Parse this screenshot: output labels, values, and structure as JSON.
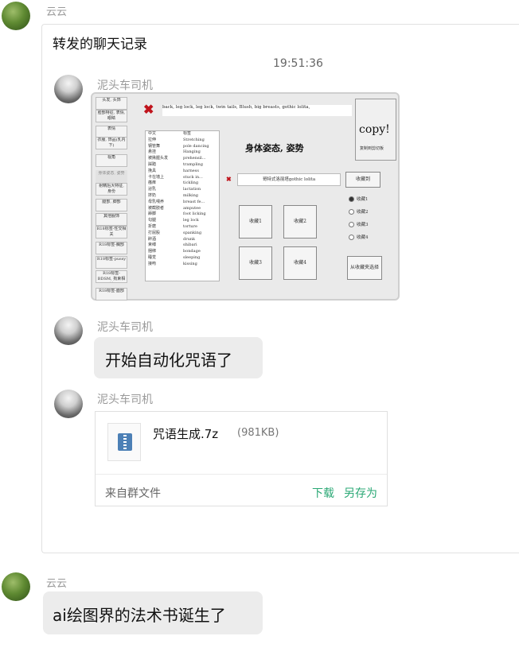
{
  "messages": {
    "m1": {
      "sender": "云云"
    },
    "forward": {
      "title": "转发的聊天记录",
      "time": "19:51:36",
      "sender1": "泥头车司机",
      "sender2": "泥头车司机",
      "sender3": "泥头车司机",
      "text2": "开始自动化咒语了",
      "file": {
        "name": "咒语生成.7z",
        "size": "(981KB)",
        "source": "来自群文件",
        "download": "下载",
        "save_as": "另存为"
      }
    },
    "m2": {
      "sender": "云云",
      "text": "ai绘图界的法术书诞生了"
    }
  },
  "app_shot": {
    "prompt_text": "back, leg lock, leg lock, twin tails, Blush, big breasts, gothic lolita,",
    "copy_label": "copy!",
    "copy_sub": "复制到剪切板",
    "side_buttons": [
      "头发, 头饰",
      "脸部特征, 表情, 眼睛",
      "表情",
      "衣服, 饰品(乳内下)",
      "视角",
      "身体姿态, 姿势",
      "射精后大特征, 身份",
      "腿部, 脚部",
      "其他服饰",
      "R18标签-性交相关",
      "R18标签-胸部",
      "R18标签-pussy",
      "R18标签-BDSM, 拘束相关",
      "R18标签-面部"
    ],
    "table_header": [
      "中文",
      "标签"
    ],
    "table_rows": [
      [
        "拉伸",
        "Stretching"
      ],
      [
        "钢管舞",
        "pole dancing"
      ],
      [
        "悬挂",
        "Hanging"
      ],
      [
        "被揪握头发",
        "prehensil..."
      ],
      [
        "踩踏",
        "trampling"
      ],
      [
        "挽具",
        "harness"
      ],
      [
        "卡在墙上",
        "stuck in..."
      ],
      [
        "瘙痒",
        "tickling"
      ],
      [
        "泌乳",
        "lactation"
      ],
      [
        "挤奶",
        "milking"
      ],
      [
        "母乳喂养",
        "breast fe..."
      ],
      [
        "被截肢者",
        "amputee"
      ],
      [
        "舔脚",
        "foot licking"
      ],
      [
        "勾腿",
        "leg lock"
      ],
      [
        "折磨",
        "torture"
      ],
      [
        "打屁股",
        "spanking"
      ],
      [
        "醉酒",
        "drunk"
      ],
      [
        "束缚",
        "shibari"
      ],
      [
        "捆绑",
        "bondage"
      ],
      [
        "睡觉",
        "sleeping"
      ],
      [
        "接吻",
        "kissing"
      ]
    ],
    "category_title": "身体姿态, 姿势",
    "fav_input": "哥特式洛丽塔gothic lolita",
    "fav_button": "收藏到",
    "radios": [
      "收藏1",
      "收藏2",
      "收藏3",
      "收藏4"
    ],
    "fav_boxes": [
      "收藏1",
      "收藏2",
      "收藏3",
      "收藏4"
    ],
    "load_button": "从收藏夹选择"
  }
}
